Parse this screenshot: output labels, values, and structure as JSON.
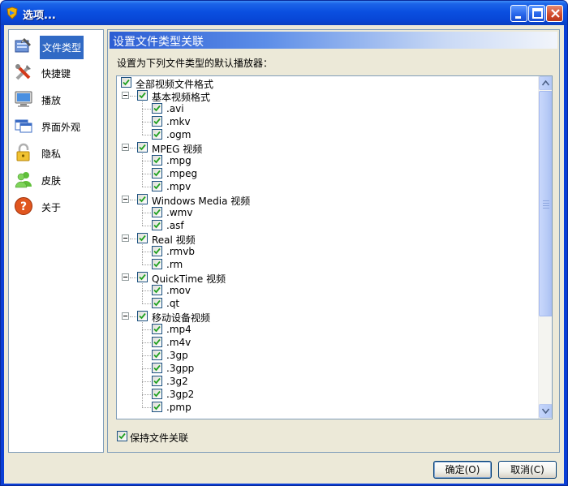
{
  "window": {
    "title": "选项..."
  },
  "sidebar": {
    "items": [
      {
        "label": "文件类型",
        "icon": "file-types-icon",
        "selected": true
      },
      {
        "label": "快捷键",
        "icon": "tools-icon",
        "selected": false
      },
      {
        "label": "播放",
        "icon": "monitor-icon",
        "selected": false
      },
      {
        "label": "界面外观",
        "icon": "window-appearance-icon",
        "selected": false
      },
      {
        "label": "隐私",
        "icon": "lock-icon",
        "selected": false
      },
      {
        "label": "皮肤",
        "icon": "users-icon",
        "selected": false
      },
      {
        "label": "关于",
        "icon": "help-icon",
        "selected": false
      }
    ]
  },
  "panel": {
    "title": "设置文件类型关联",
    "description": "设置为下列文件类型的默认播放器："
  },
  "tree": {
    "root": "全部视频文件格式",
    "groups": [
      {
        "label": "基本视频格式",
        "items": [
          ".avi",
          ".mkv",
          ".ogm"
        ]
      },
      {
        "label": "MPEG 视频",
        "items": [
          ".mpg",
          ".mpeg",
          ".mpv"
        ]
      },
      {
        "label": "Windows Media 视频",
        "items": [
          ".wmv",
          ".asf"
        ]
      },
      {
        "label": "Real 视频",
        "items": [
          ".rmvb",
          ".rm"
        ]
      },
      {
        "label": "QuickTime 视频",
        "items": [
          ".mov",
          ".qt"
        ]
      },
      {
        "label": "移动设备视频",
        "items": [
          ".mp4",
          ".m4v",
          ".3gp",
          ".3gpp",
          ".3g2",
          ".3gp2",
          ".pmp"
        ]
      }
    ]
  },
  "keep_association": {
    "label": "保持文件关联",
    "checked": true
  },
  "buttons": {
    "ok": "确定(O)",
    "cancel": "取消(C)"
  },
  "colors": {
    "titlebar": "#0a4fe0",
    "selection": "#316ac5",
    "border": "#7f9db9",
    "client": "#ece9d8"
  }
}
